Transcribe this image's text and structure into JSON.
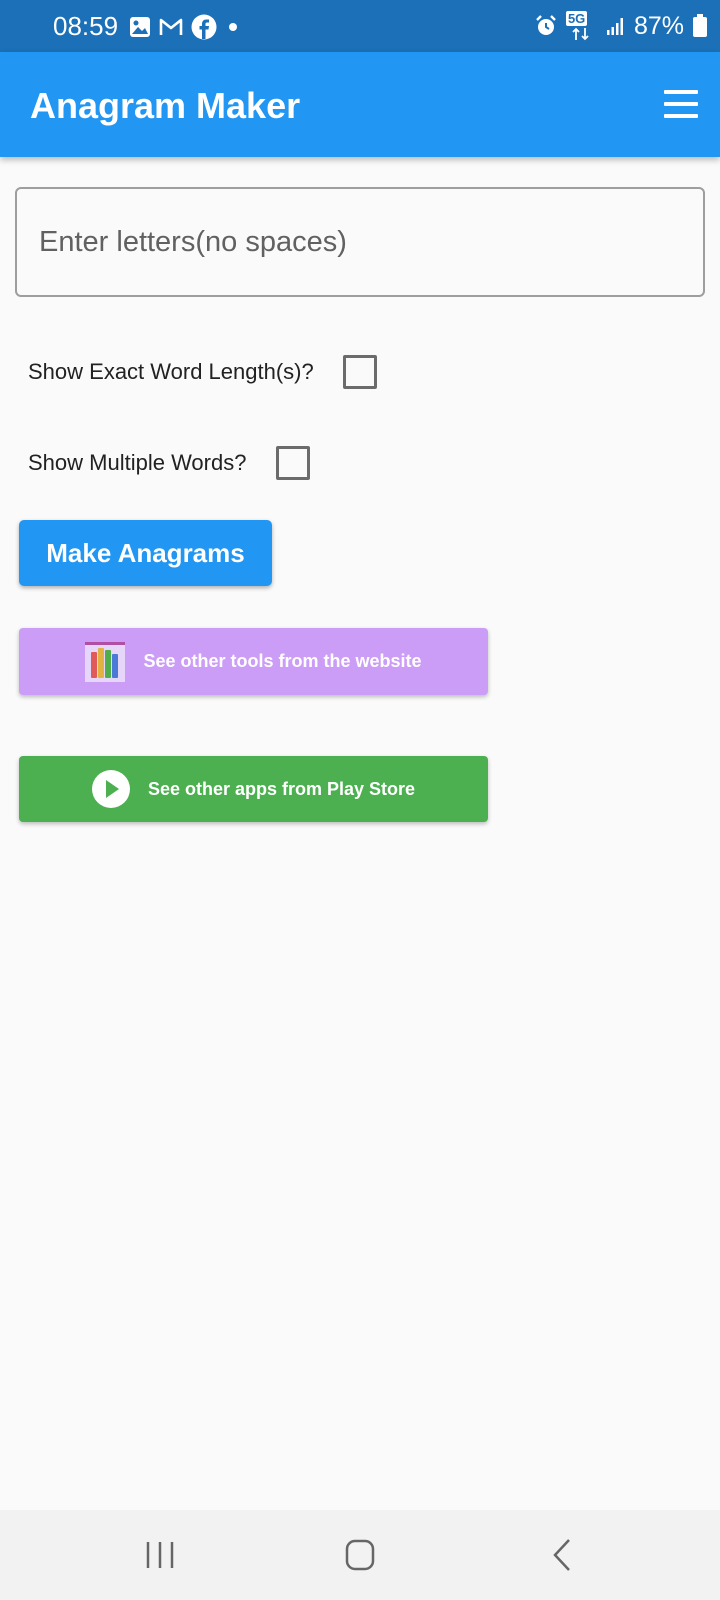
{
  "status_bar": {
    "time": "08:59",
    "battery": "87%",
    "network": "5G",
    "left_icons": [
      "gallery-icon",
      "gmail-icon",
      "facebook-icon",
      "dot-icon"
    ],
    "right_icons": [
      "alarm-icon",
      "5g-icon",
      "signal-icon",
      "battery-icon"
    ]
  },
  "app_bar": {
    "title": "Anagram Maker",
    "menu_icon": "hamburger-menu-icon"
  },
  "letters_input": {
    "placeholder": "Enter letters(no spaces)",
    "value": ""
  },
  "options": {
    "exact_length_label": "Show Exact Word Length(s)?",
    "exact_length_checked": false,
    "multiple_words_label": "Show Multiple Words?",
    "multiple_words_checked": false
  },
  "buttons": {
    "make_anagrams": "Make Anagrams",
    "other_tools": "See other tools from the website",
    "other_apps": "See other apps from Play Store"
  },
  "colors": {
    "status_bar": "#1b70b8",
    "app_bar": "#2196f3",
    "primary_button": "#2196f3",
    "tools_button": "#cc9df7",
    "store_button": "#4caf50"
  },
  "nav_bar": {
    "icons": [
      "recent-apps-icon",
      "home-icon",
      "back-icon"
    ]
  }
}
